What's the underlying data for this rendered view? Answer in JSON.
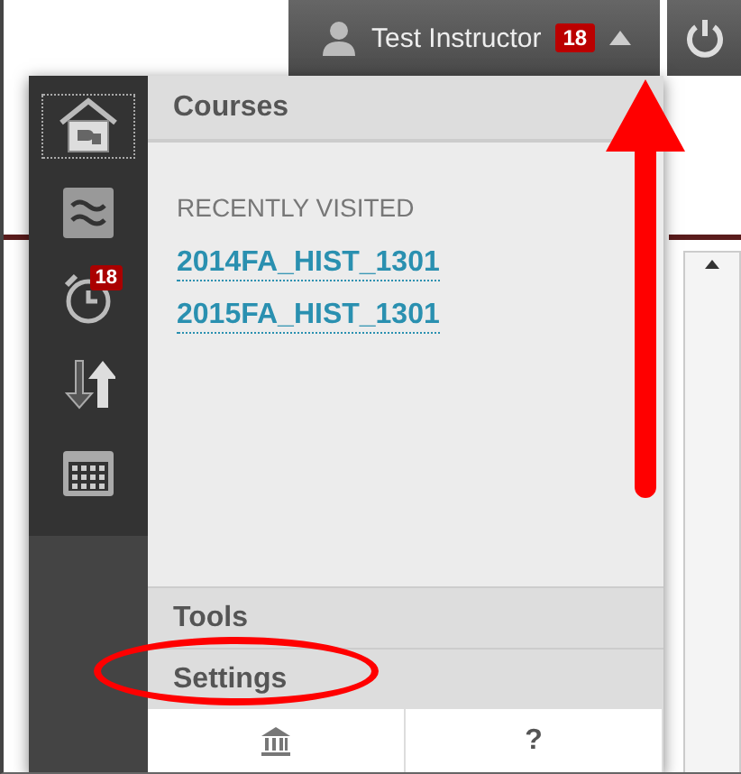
{
  "user_bar": {
    "user_name": "Test Instructor",
    "notification_count": "18"
  },
  "sidebar": {
    "items": [
      {
        "kind": "home",
        "focused": true
      },
      {
        "kind": "stream",
        "focused": false
      },
      {
        "kind": "alarm",
        "focused": false,
        "badge": "18"
      },
      {
        "kind": "updates",
        "focused": false
      },
      {
        "kind": "calendar",
        "focused": false
      }
    ]
  },
  "menu": {
    "header": "Courses",
    "section_label": "RECENTLY VISITED",
    "links": [
      "2014FA_HIST_1301",
      "2015FA_HIST_1301"
    ],
    "rows": [
      {
        "label": "Tools",
        "circled": false
      },
      {
        "label": "Settings",
        "circled": true
      }
    ],
    "footer": [
      {
        "kind": "institution"
      },
      {
        "kind": "help",
        "label": "?"
      }
    ]
  }
}
